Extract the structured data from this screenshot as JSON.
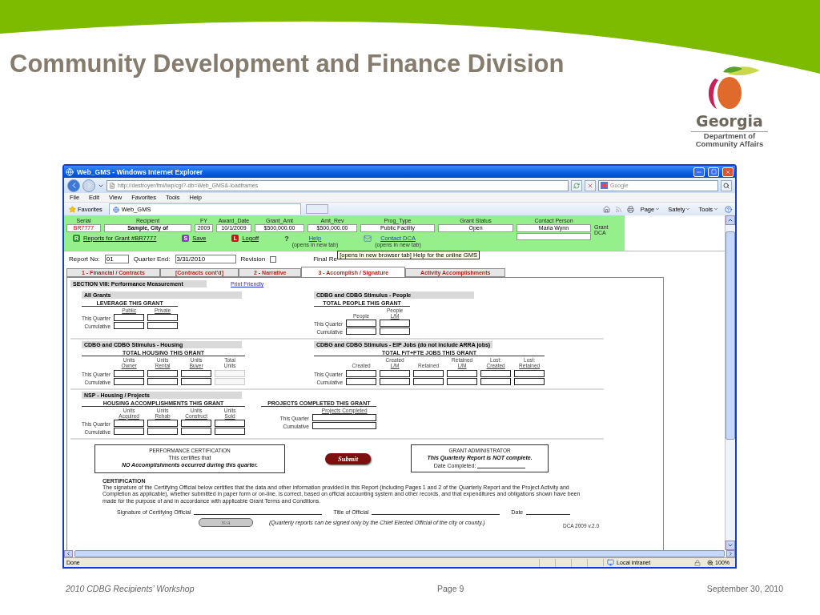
{
  "slide": {
    "title": "Community Development and Finance Division",
    "logo": {
      "name": "Georgia",
      "department": "Department of",
      "agency": "Community Affairs"
    }
  },
  "window": {
    "title": "Web_GMS - Windows Internet Explorer"
  },
  "address_bar": {
    "url": "http://destroyer/fmi/iwp/cgi?-db=Web_GMS&-loadframes",
    "search_placeholder": "Google"
  },
  "menu": [
    "File",
    "Edit",
    "View",
    "Favorites",
    "Tools",
    "Help"
  ],
  "favorites_bar": {
    "favorites": "Favorites",
    "tab": "Web_GMS",
    "commands": [
      "Page",
      "Safety",
      "Tools"
    ]
  },
  "grant_header": {
    "fields": [
      {
        "label": "Serial",
        "value": "BR7777"
      },
      {
        "label": "Recipient",
        "value": "Sample, City of"
      },
      {
        "label": "FY",
        "value": "2009"
      },
      {
        "label": "Award_Date",
        "value": "10/1/2009"
      },
      {
        "label": "Grant_Amt",
        "value": "$500,000.00"
      },
      {
        "label": "Amt_Rev",
        "value": "$500,000.00"
      },
      {
        "label": "Prog_Type",
        "value": "Public Facility"
      },
      {
        "label": "Grant Status",
        "value": "Open"
      },
      {
        "label": "Contact Person",
        "value": "Maria Wynn"
      }
    ],
    "contact_labels": [
      "Grant",
      "DCA"
    ],
    "links": [
      {
        "kind": "badge",
        "badge": "R",
        "color": "#1f9a1f",
        "label": "Reports for Grant #BR7777"
      },
      {
        "kind": "badge",
        "badge": "S",
        "color": "#8a3bc4",
        "label": "Save"
      },
      {
        "kind": "badge",
        "badge": "L",
        "color": "#d01010",
        "label": "Logoff"
      },
      {
        "kind": "help",
        "badge": "?",
        "label": "Help",
        "note": "(opens in new tab)"
      },
      {
        "kind": "mail",
        "label": "Contact DCA",
        "note": "(opens in new tab)"
      }
    ]
  },
  "report": {
    "report_no_label": "Report No:",
    "report_no": "01",
    "quarter_end_label": "Quarter End:",
    "quarter_end": "3/31/2010",
    "revision_label": "Revision",
    "revision_checked": false,
    "final_label": "Final Re",
    "tooltip": "[opens in new browser tab]  Help for the online GMS"
  },
  "tabs": [
    {
      "label": "1 - Financial / Contracts",
      "selected": false
    },
    {
      "label": "[Contracts cont'd]",
      "selected": false
    },
    {
      "label": "2 - Narrative",
      "selected": false
    },
    {
      "label": "3 - Accomplish / Signature",
      "selected": true
    },
    {
      "label": "Activity Accomplishments",
      "selected": false
    }
  ],
  "form": {
    "section": "SECTION VIII: Performance Measurement",
    "print_link": "Print Friendly",
    "rows": [
      {
        "blocks": [
          {
            "heading": "All Grants",
            "groups": [
              {
                "title": "LEVERAGE THIS GRANT",
                "row_labels": [
                  "This Quarter",
                  "Cumulative"
                ],
                "columns": [
                  {
                    "sub": "Public",
                    "disabled": false
                  },
                  {
                    "sub": "Private",
                    "disabled": false
                  }
                ]
              }
            ]
          },
          {
            "heading": "CDBG and CDBG Stimulus - People",
            "groups": [
              {
                "title": "TOTAL PEOPLE THIS GRANT",
                "row_labels": [
                  "This Quarter",
                  "Cumulative"
                ],
                "columns": [
                  {
                    "top": [
                      "People"
                    ],
                    "disabled": false
                  },
                  {
                    "top": [
                      "People"
                    ],
                    "sub": "L/M",
                    "disabled": false
                  }
                ]
              }
            ]
          }
        ]
      },
      {
        "blocks": [
          {
            "heading": "CDBG and CDBG Stimulus - Housing",
            "groups": [
              {
                "title": "TOTAL HOUSING THIS GRANT",
                "row_labels": [
                  "This Quarter",
                  "Cumulative"
                ],
                "columns": [
                  {
                    "top": [
                      "Units"
                    ],
                    "sub": "Owner",
                    "disabled": false
                  },
                  {
                    "top": [
                      "Units"
                    ],
                    "sub": "Rental",
                    "disabled": false
                  },
                  {
                    "top": [
                      "Units"
                    ],
                    "sub": "Buyer",
                    "disabled": false
                  },
                  {
                    "top": [
                      "Total",
                      "Units"
                    ],
                    "disabled": true
                  }
                ]
              }
            ]
          },
          {
            "heading": "CDBG and CDBG Stimulus - EIP Jobs (do not include ARRA jobs)",
            "groups": [
              {
                "title": "TOTAL F/T+FTE JOBS THIS GRANT",
                "row_labels": [
                  "This Quarter",
                  "Cumulative"
                ],
                "columns": [
                  {
                    "top": [
                      "Created"
                    ],
                    "disabled": false
                  },
                  {
                    "top": [
                      "Created"
                    ],
                    "sub": "L/M",
                    "disabled": false
                  },
                  {
                    "top": [
                      "Retained"
                    ],
                    "disabled": false
                  },
                  {
                    "top": [
                      "Retained"
                    ],
                    "sub": "L/M",
                    "disabled": false
                  },
                  {
                    "top": [
                      "Lost:"
                    ],
                    "sub": "Created",
                    "disabled": false
                  },
                  {
                    "top": [
                      "Lost:"
                    ],
                    "sub": "Retained",
                    "disabled": false
                  }
                ]
              }
            ]
          }
        ]
      },
      {
        "blocks": [
          {
            "heading": "NSP - Housing / Projects",
            "groups": [
              {
                "title": "HOUSING ACCOMPLISHMENTS THIS GRANT",
                "row_labels": [
                  "This Quarter",
                  "Cumulative"
                ],
                "columns": [
                  {
                    "top": [
                      "Units"
                    ],
                    "sub": "Acquired",
                    "disabled": false
                  },
                  {
                    "top": [
                      "Units"
                    ],
                    "sub": "Rehab",
                    "disabled": false
                  },
                  {
                    "top": [
                      "Units"
                    ],
                    "sub": "Construct",
                    "disabled": false
                  },
                  {
                    "top": [
                      "Units"
                    ],
                    "sub": "Sold",
                    "disabled": false
                  }
                ]
              },
              {
                "title": "PROJECTS COMPLETED THIS GRANT",
                "row_labels": [
                  "This Quarter",
                  "Cumulative"
                ],
                "columns": [
                  {
                    "sub": "Projects Completed",
                    "disabled": false
                  }
                ]
              }
            ]
          }
        ]
      }
    ]
  },
  "certification": {
    "performance": {
      "title": "PERFORMANCE CERTIFICATION",
      "line": "This certifies that",
      "statement": "NO Accomplishments occurred during this quarter."
    },
    "submit": "Submit",
    "administrator": {
      "title": "GRANT ADMINISTRATOR",
      "statement": "This Quarterly Report is NOT complete.",
      "date_label": "Date Completed:"
    },
    "heading": "CERTIFICATION",
    "text": "The signature of the Certifying Official below certifies that the data and other information provided in this Report (including Pages 1 and 2 of the Quarterly Report and the Project Activity and Completion as applicable), whether submitted in paper form or on-line, is correct, based on official accounting system and other records, and that expenditures and obligations shown have been made for the purpose of and in accordance with applicable Grant Terms and Conditions.",
    "signature_fields": [
      "Signature of Certifying Official",
      "Title of Official",
      "Date"
    ],
    "version": "DCA 2009 v.2.0",
    "sign_button": {
      "label": "N/A",
      "disabled": true
    },
    "note": "(Quarterly reports can be signed only by the Chief Elected Official of the city or county.)"
  },
  "status_bar": {
    "text": "Done",
    "zone": "Local intranet",
    "zoom": "100%"
  },
  "footer": {
    "left": "2010 CDBG Recipients’ Workshop",
    "center": "Page 9",
    "right": "September 30, 2010"
  }
}
